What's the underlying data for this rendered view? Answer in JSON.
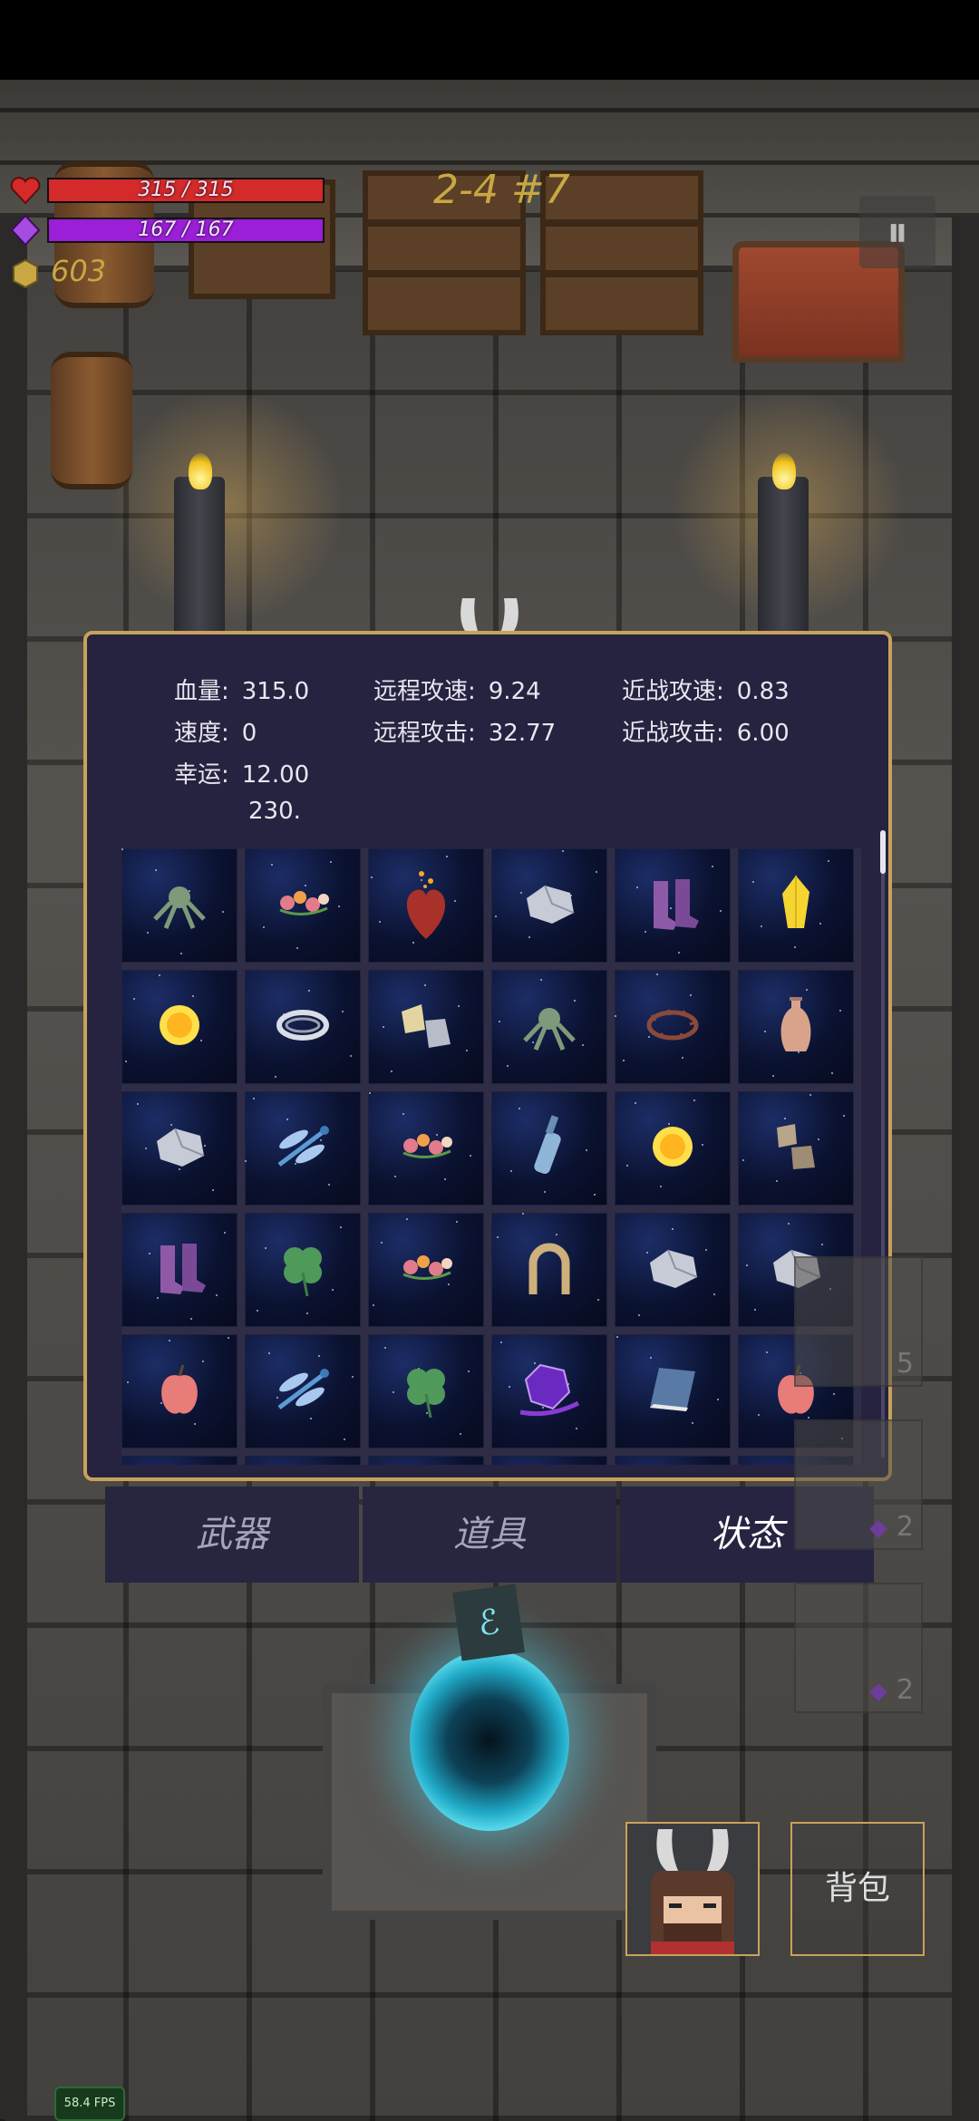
{
  "hud": {
    "hp_text": "315 / 315",
    "hp_fraction": 1.0,
    "mp_text": "167 / 167",
    "mp_fraction": 1.0,
    "gold": "603",
    "level": "2-4 #7",
    "pause_icon": "pause-icon"
  },
  "stats": {
    "rows": [
      [
        {
          "label": "血量:",
          "value": "315.0"
        },
        {
          "label": "远程攻速:",
          "value": "9.24"
        },
        {
          "label": "近战攻速:",
          "value": "0.83"
        }
      ],
      [
        {
          "label": "速度:",
          "value": "0"
        },
        {
          "label": "远程攻击:",
          "value": "32.77"
        },
        {
          "label": "近战攻击:",
          "value": "6.00"
        }
      ],
      [
        {
          "label": "幸运:",
          "value": "12.00"
        }
      ]
    ],
    "extra_value": "230."
  },
  "items": [
    [
      "octopus-icon",
      "flower-garland-icon",
      "heart-icon",
      "stone-icon",
      "boots-icon",
      "yellow-crystal-icon"
    ],
    [
      "sun-orb-icon",
      "ring-icon",
      "ore-icon",
      "octopus-icon",
      "thorn-crown-icon",
      "vase-icon"
    ],
    [
      "stone-icon",
      "dragonfly-icon",
      "flower-garland-icon",
      "bottle-icon",
      "sun-orb-icon",
      "rock-chunk-icon"
    ],
    [
      "boots-icon",
      "clover-icon",
      "flower-garland-icon",
      "horseshoe-icon",
      "stone-icon",
      "stone-icon"
    ],
    [
      "apple-icon",
      "dragonfly-icon",
      "clover-icon",
      "purple-gem-icon",
      "book-icon",
      "apple-icon"
    ]
  ],
  "tabs": [
    {
      "label": "武器",
      "active": false
    },
    {
      "label": "道具",
      "active": false
    },
    {
      "label": "状态",
      "active": true
    }
  ],
  "side_slots": [
    {
      "count": "5"
    },
    {
      "count": "2"
    },
    {
      "count": "2"
    }
  ],
  "bag_label": "背包",
  "fps": "58.4 FPS",
  "colors": {
    "hp": "#d42a2a",
    "mp": "#9b1fd6",
    "gold": "#c9a743",
    "panel": "#25233f",
    "panel_border": "#c8a25a"
  }
}
